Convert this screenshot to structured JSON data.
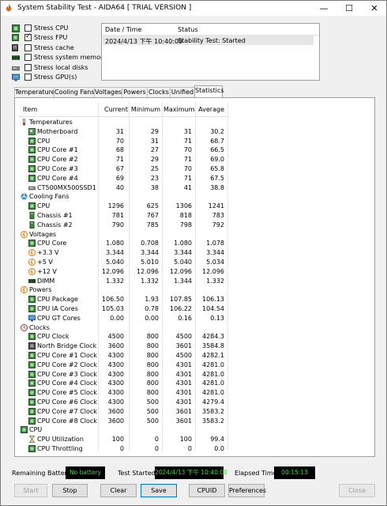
{
  "window": {
    "title": "System Stability Test - AIDA64  [ TRIAL VERSION ]"
  },
  "stress_options": [
    {
      "label": "Stress CPU",
      "checked": false,
      "icon": "cpu-chip-icon"
    },
    {
      "label": "Stress FPU",
      "checked": true,
      "icon": "fpu-chip-icon"
    },
    {
      "label": "Stress cache",
      "checked": false,
      "icon": "cache-icon"
    },
    {
      "label": "Stress system memory",
      "checked": false,
      "icon": "memory-module-icon"
    },
    {
      "label": "Stress local disks",
      "checked": false,
      "icon": "disk-drive-icon"
    },
    {
      "label": "Stress GPU(s)",
      "checked": false,
      "icon": "monitor-icon"
    }
  ],
  "log": {
    "col_date": "Date / Time",
    "col_status": "Status",
    "rows": [
      {
        "date": "2024/4/13 下午 10:40:00",
        "status": "Stability Test: Started"
      }
    ]
  },
  "tabs": [
    "Temperatures",
    "Cooling Fans",
    "Voltages",
    "Powers",
    "Clocks",
    "Unified",
    "Statistics"
  ],
  "active_tab": "Statistics",
  "stats": {
    "columns": [
      "Item",
      "Current",
      "Minimum",
      "Maximum",
      "Average"
    ],
    "rows": [
      {
        "type": "group",
        "item": "Temperatures",
        "icon": "thermometer-icon"
      },
      {
        "type": "item",
        "item": "Motherboard",
        "icon": "motherboard-icon",
        "current": "31",
        "min": "29",
        "max": "31",
        "avg": "30.2"
      },
      {
        "type": "item",
        "item": "CPU",
        "icon": "cpu-chip-icon",
        "current": "70",
        "min": "31",
        "max": "71",
        "avg": "68.7"
      },
      {
        "type": "item",
        "item": "CPU Core #1",
        "icon": "cpu-chip-icon",
        "current": "68",
        "min": "27",
        "max": "70",
        "avg": "66.5"
      },
      {
        "type": "item",
        "item": "CPU Core #2",
        "icon": "cpu-chip-icon",
        "current": "71",
        "min": "29",
        "max": "71",
        "avg": "69.0"
      },
      {
        "type": "item",
        "item": "CPU Core #3",
        "icon": "cpu-chip-icon",
        "current": "67",
        "min": "25",
        "max": "70",
        "avg": "65.8"
      },
      {
        "type": "item",
        "item": "CPU Core #4",
        "icon": "cpu-chip-icon",
        "current": "69",
        "min": "23",
        "max": "71",
        "avg": "67.5"
      },
      {
        "type": "item",
        "item": "CT500MX500SSD1",
        "icon": "disk-drive-icon",
        "current": "40",
        "min": "38",
        "max": "41",
        "avg": "38.8"
      },
      {
        "type": "group",
        "item": "Cooling Fans",
        "icon": "fan-icon"
      },
      {
        "type": "item",
        "item": "CPU",
        "icon": "cpu-chip-icon",
        "current": "1296",
        "min": "625",
        "max": "1306",
        "avg": "1241"
      },
      {
        "type": "item",
        "item": "Chassis #1",
        "icon": "chassis-icon",
        "current": "781",
        "min": "767",
        "max": "818",
        "avg": "783"
      },
      {
        "type": "item",
        "item": "Chassis #2",
        "icon": "chassis-icon",
        "current": "790",
        "min": "785",
        "max": "798",
        "avg": "792"
      },
      {
        "type": "group",
        "item": "Voltages",
        "icon": "voltage-icon"
      },
      {
        "type": "item",
        "item": "CPU Core",
        "icon": "cpu-chip-icon",
        "current": "1.080",
        "min": "0.708",
        "max": "1.080",
        "avg": "1.078"
      },
      {
        "type": "item",
        "item": "+3.3 V",
        "icon": "voltage-icon",
        "current": "3.344",
        "min": "3.344",
        "max": "3.344",
        "avg": "3.344"
      },
      {
        "type": "item",
        "item": "+5 V",
        "icon": "voltage-icon",
        "current": "5.040",
        "min": "5.010",
        "max": "5.040",
        "avg": "5.034"
      },
      {
        "type": "item",
        "item": "+12 V",
        "icon": "voltage-icon",
        "current": "12.096",
        "min": "12.096",
        "max": "12.096",
        "avg": "12.096"
      },
      {
        "type": "item",
        "item": "DIMM",
        "icon": "memory-module-icon",
        "current": "1.332",
        "min": "1.332",
        "max": "1.344",
        "avg": "1.332"
      },
      {
        "type": "group",
        "item": "Powers",
        "icon": "power-icon"
      },
      {
        "type": "item",
        "item": "CPU Package",
        "icon": "cpu-chip-icon",
        "current": "106.50",
        "min": "1.93",
        "max": "107.85",
        "avg": "106.13"
      },
      {
        "type": "item",
        "item": "CPU IA Cores",
        "icon": "cpu-chip-icon",
        "current": "105.03",
        "min": "0.78",
        "max": "106.22",
        "avg": "104.54"
      },
      {
        "type": "item",
        "item": "CPU GT Cores",
        "icon": "monitor-icon",
        "current": "0.00",
        "min": "0.00",
        "max": "0.16",
        "avg": "0.13"
      },
      {
        "type": "group",
        "item": "Clocks",
        "icon": "clock-icon"
      },
      {
        "type": "item",
        "item": "CPU Clock",
        "icon": "cpu-chip-icon",
        "current": "4500",
        "min": "800",
        "max": "4500",
        "avg": "4284.3"
      },
      {
        "type": "item",
        "item": "North Bridge Clock",
        "icon": "chipset-icon",
        "current": "3600",
        "min": "800",
        "max": "3601",
        "avg": "3584.8"
      },
      {
        "type": "item",
        "item": "CPU Core #1 Clock",
        "icon": "cpu-chip-icon",
        "current": "4300",
        "min": "800",
        "max": "4500",
        "avg": "4282.1"
      },
      {
        "type": "item",
        "item": "CPU Core #2 Clock",
        "icon": "cpu-chip-icon",
        "current": "4300",
        "min": "800",
        "max": "4301",
        "avg": "4281.0"
      },
      {
        "type": "item",
        "item": "CPU Core #3 Clock",
        "icon": "cpu-chip-icon",
        "current": "4300",
        "min": "800",
        "max": "4301",
        "avg": "4281.0"
      },
      {
        "type": "item",
        "item": "CPU Core #4 Clock",
        "icon": "cpu-chip-icon",
        "current": "4300",
        "min": "800",
        "max": "4301",
        "avg": "4281.0"
      },
      {
        "type": "item",
        "item": "CPU Core #5 Clock",
        "icon": "cpu-chip-icon",
        "current": "4300",
        "min": "800",
        "max": "4301",
        "avg": "4281.0"
      },
      {
        "type": "item",
        "item": "CPU Core #6 Clock",
        "icon": "cpu-chip-icon",
        "current": "4300",
        "min": "500",
        "max": "4301",
        "avg": "4279.4"
      },
      {
        "type": "item",
        "item": "CPU Core #7 Clock",
        "icon": "cpu-chip-icon",
        "current": "3600",
        "min": "500",
        "max": "3601",
        "avg": "3583.2"
      },
      {
        "type": "item",
        "item": "CPU Core #8 Clock",
        "icon": "cpu-chip-icon",
        "current": "3600",
        "min": "500",
        "max": "3601",
        "avg": "3583.2"
      },
      {
        "type": "group",
        "item": "CPU",
        "icon": "cpu-chip-icon"
      },
      {
        "type": "item",
        "item": "CPU Utilization",
        "icon": "hourglass-icon",
        "current": "100",
        "min": "0",
        "max": "100",
        "avg": "99.4"
      },
      {
        "type": "item",
        "item": "CPU Throttling",
        "icon": "cpu-chip-icon",
        "current": "0",
        "min": "0",
        "max": "0",
        "avg": "0.0"
      }
    ]
  },
  "status_bar": {
    "battery_label": "Remaining Battery:",
    "battery_value": "No battery",
    "started_label": "Test Started:",
    "started_value": "2024/4/13 下午 10:40:00",
    "elapsed_label": "Elapsed Time:",
    "elapsed_value": "00:15:13"
  },
  "buttons": {
    "start": "Start",
    "stop": "Stop",
    "clear": "Clear",
    "save": "Save",
    "cpuid": "CPUID",
    "preferences": "Preferences",
    "close": "Close"
  },
  "colors": {
    "status_text": "#3fd23f",
    "status_bg": "#000000",
    "default_button_border": "#0078d7"
  }
}
